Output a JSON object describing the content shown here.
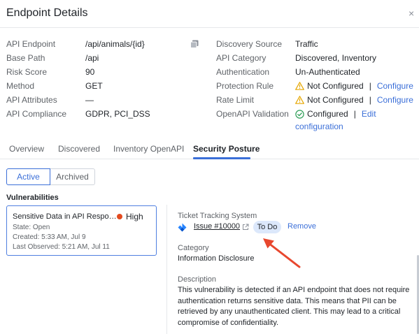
{
  "header": {
    "title": "Endpoint Details",
    "close_glyph": "×"
  },
  "left_props": [
    {
      "label": "API Endpoint",
      "value": "/api/animals/{id}"
    },
    {
      "label": "Base Path",
      "value": "/api"
    },
    {
      "label": "Risk Score",
      "value": "90"
    },
    {
      "label": "Method",
      "value": "GET"
    },
    {
      "label": "API Attributes",
      "value": "—"
    },
    {
      "label": "API Compliance",
      "value": "GDPR, PCI_DSS"
    }
  ],
  "right_props": {
    "discovery_source": {
      "label": "Discovery Source",
      "value": "Traffic"
    },
    "api_category": {
      "label": "API Category",
      "value": "Discovered, Inventory"
    },
    "authentication": {
      "label": "Authentication",
      "value": "Un-Authenticated"
    },
    "protection_rule": {
      "label": "Protection Rule",
      "value": "Not Configured",
      "sep": "|",
      "action": "Configure"
    },
    "rate_limit": {
      "label": "Rate Limit",
      "value": "Not Configured",
      "sep": "|",
      "action": "Configure"
    },
    "openapi_validation": {
      "label": "OpenAPI Validation",
      "value": "Configured",
      "sep": "|",
      "action": "Edit configuration"
    }
  },
  "tabs": [
    {
      "label": "Overview"
    },
    {
      "label": "Discovered"
    },
    {
      "label": "Inventory OpenAPI"
    },
    {
      "label": "Security Posture",
      "active": true
    }
  ],
  "toggle": {
    "active": "Active",
    "archived": "Archived"
  },
  "vulnerabilities": {
    "title": "Vulnerabilities",
    "card": {
      "name": "Sensitive Data in API Response with Unauthenticated Access",
      "severity": "High",
      "state": "State: Open",
      "created": "Created: 5:33 AM, Jul 9",
      "last_observed": "Last Observed: 5:21 AM, Jul 11"
    }
  },
  "detail": {
    "ticket_label": "Ticket Tracking System",
    "issue": "Issue #10000",
    "status": "To Do",
    "remove": "Remove",
    "category_label": "Category",
    "category_value": "Information Disclosure",
    "description_label": "Description",
    "description": "This vulnerability is detected if an API endpoint that does not require authentication returns sensitive data. This means that PII can be retrieved by any unauthenticated client. This may lead to a critical compromise of confidentiality."
  },
  "colors": {
    "accent": "#3b6fd8",
    "warning": "#e6a700",
    "success": "#2e9e57",
    "severity_high": "#e34a1f",
    "annotation_arrow": "#e8472e"
  },
  "icons": [
    "close-icon",
    "copy-icon",
    "warning-icon",
    "check-circle-icon",
    "jira-icon",
    "external-link-icon",
    "arrow-annotation"
  ]
}
